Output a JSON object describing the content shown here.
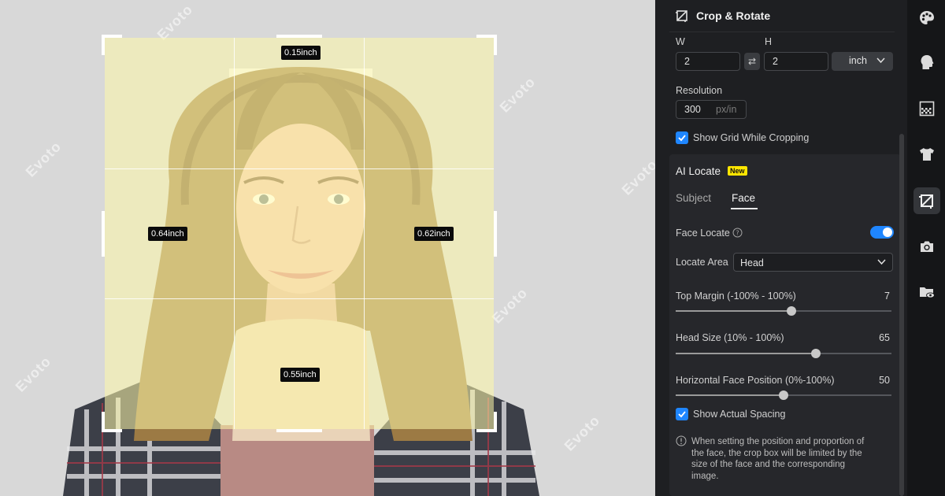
{
  "canvas": {
    "watermark": "Evoto",
    "measurements": {
      "top": "0.15inch",
      "left": "0.64inch",
      "right": "0.62inch",
      "bottom": "0.55inch"
    }
  },
  "panel": {
    "title": "Crop & Rotate",
    "width_label": "W",
    "height_label": "H",
    "width_value": "2",
    "height_value": "2",
    "swap_symbol": "⇄",
    "unit": "inch",
    "resolution_label": "Resolution",
    "resolution_value": "300",
    "resolution_unit": "px/in",
    "show_grid_label": "Show Grid While Cropping",
    "show_grid_checked": true,
    "ai_locate": {
      "title": "AI Locate",
      "badge": "New",
      "tabs": [
        {
          "label": "Subject",
          "active": false
        },
        {
          "label": "Face",
          "active": true
        }
      ],
      "face_locate_label": "Face Locate",
      "face_locate_on": true,
      "locate_area_label": "Locate Area",
      "locate_area_value": "Head",
      "sliders": [
        {
          "label": "Top Margin (-100% - 100%)",
          "value": "7",
          "fraction": 0.535
        },
        {
          "label": "Head Size (10% - 100%)",
          "value": "65",
          "fraction": 0.65
        },
        {
          "label": "Horizontal Face Position (0%-100%)",
          "value": "50",
          "fraction": 0.5
        }
      ],
      "show_spacing_label": "Show Actual Spacing",
      "show_spacing_checked": true,
      "info_lines": [
        "When setting the position and proportion of",
        "the face, the crop box will be limited by the",
        "size of the face and the corresponding",
        "image."
      ]
    }
  },
  "toolbar": {
    "items": [
      {
        "icon": "palette-icon",
        "active": false
      },
      {
        "icon": "head-icon",
        "active": false
      },
      {
        "icon": "background-pattern-icon",
        "active": false
      },
      {
        "icon": "tshirt-icon",
        "active": false
      },
      {
        "icon": "crop-icon",
        "active": true
      },
      {
        "icon": "camera-icon",
        "active": false
      },
      {
        "icon": "folder-eye-icon",
        "active": false
      }
    ]
  }
}
